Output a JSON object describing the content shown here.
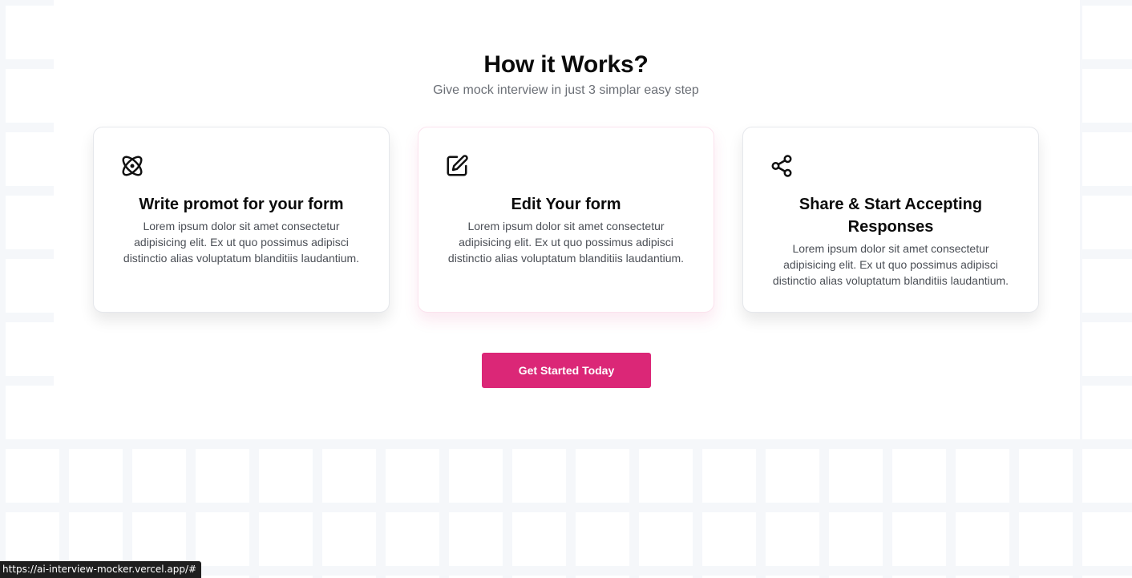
{
  "section": {
    "title": "How it Works?",
    "subtitle": "Give mock interview in just 3 simplar easy step"
  },
  "steps": [
    {
      "icon": "atom-icon",
      "title": "Write promot for your form",
      "text": "Lorem ipsum dolor sit amet consectetur adipisicing elit. Ex ut quo possimus adipisci distinctio alias voluptatum blanditiis laudantium."
    },
    {
      "icon": "edit-icon",
      "title": "Edit Your form",
      "text": "Lorem ipsum dolor sit amet consectetur adipisicing elit. Ex ut quo possimus adipisci distinctio alias voluptatum blanditiis laudantium."
    },
    {
      "icon": "share-icon",
      "title": "Share & Start Accepting Responses",
      "text": "Lorem ipsum dolor sit amet consectetur adipisicing elit. Ex ut quo possimus adipisci distinctio alias voluptatum blanditiis laudantium."
    }
  ],
  "cta": {
    "label": "Get Started Today"
  },
  "status_bar": {
    "url": "https://ai-interview-mocker.vercel.app/#"
  },
  "colors": {
    "accent": "#db2777",
    "heading": "#0b0b0b",
    "muted": "#6b6f76"
  }
}
